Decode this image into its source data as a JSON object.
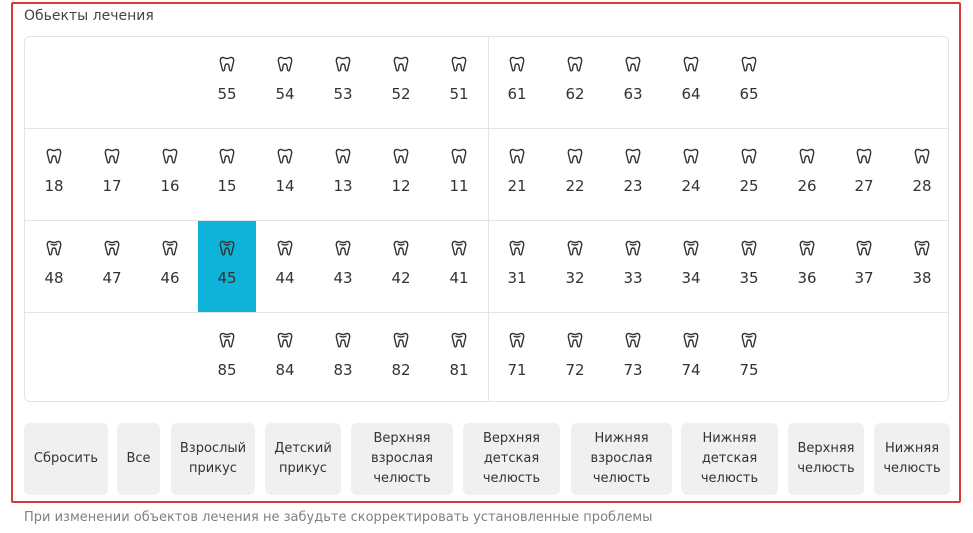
{
  "title": "Обьекты лечения",
  "hint": "При изменении объектов лечения не забудьте скорректировать установленные проблемы",
  "accent_color": "#0db3d9",
  "frame_color": "#d6393a",
  "rows": [
    {
      "teeth": [
        "55",
        "54",
        "53",
        "52",
        "51",
        "61",
        "62",
        "63",
        "64",
        "65"
      ],
      "icon": "upper-tooth-icon"
    },
    {
      "teeth": [
        "18",
        "17",
        "16",
        "15",
        "14",
        "13",
        "12",
        "11",
        "21",
        "22",
        "23",
        "24",
        "25",
        "26",
        "27",
        "28"
      ],
      "icon": "upper-tooth-icon"
    },
    {
      "teeth": [
        "48",
        "47",
        "46",
        "45",
        "44",
        "43",
        "42",
        "41",
        "31",
        "32",
        "33",
        "34",
        "35",
        "36",
        "37",
        "38"
      ],
      "icon": "lower-tooth-icon"
    },
    {
      "teeth": [
        "85",
        "84",
        "83",
        "82",
        "81",
        "71",
        "72",
        "73",
        "74",
        "75"
      ],
      "icon": "lower-tooth-icon"
    }
  ],
  "selected_tooth": "45",
  "buttons": [
    {
      "id": "reset",
      "label": "Сбросить"
    },
    {
      "id": "all",
      "label": "Все"
    },
    {
      "id": "adult",
      "label": "Взрослый\nприкус"
    },
    {
      "id": "child",
      "label": "Детский\nприкус"
    },
    {
      "id": "upper-adult",
      "label": "Верхняя\nвзрослая\nчелюсть"
    },
    {
      "id": "upper-child",
      "label": "Верхняя\nдетская\nчелюсть"
    },
    {
      "id": "lower-adult",
      "label": "Нижняя\nвзрослая\nчелюсть"
    },
    {
      "id": "lower-child",
      "label": "Нижняя\nдетская\nчелюсть"
    },
    {
      "id": "upper-jaw",
      "label": "Верхняя\nчелюсть"
    },
    {
      "id": "lower-jaw",
      "label": "Нижняя\nчелюсть"
    }
  ]
}
